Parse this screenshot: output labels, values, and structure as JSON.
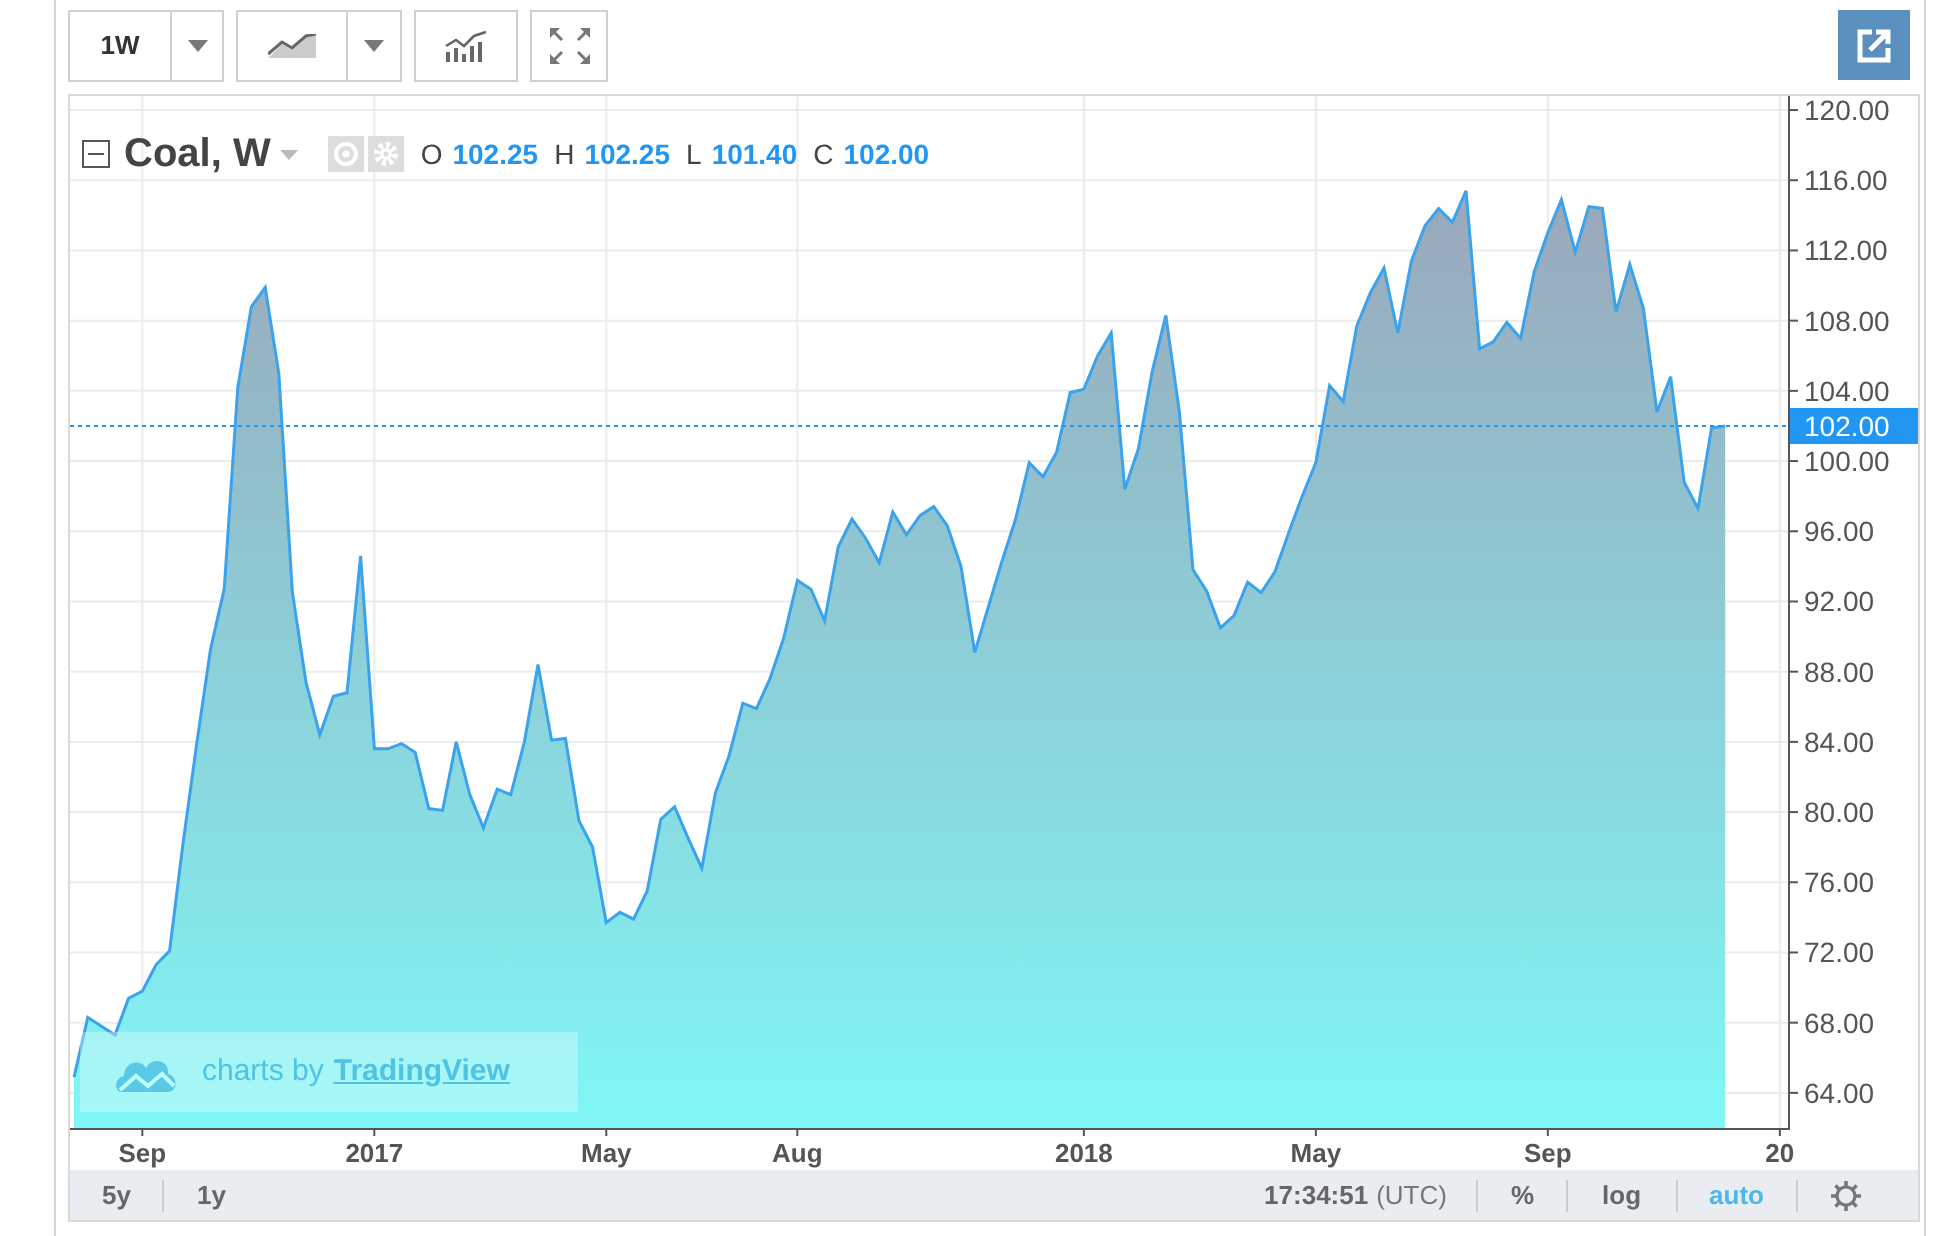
{
  "toolbar": {
    "interval": "1W"
  },
  "legend": {
    "values": [
      {
        "label": "O",
        "value": "102.25"
      },
      {
        "label": "H",
        "value": "102.25"
      },
      {
        "label": "L",
        "value": "101.40"
      },
      {
        "label": "C",
        "value": "102.00"
      }
    ]
  },
  "chart": {
    "chart_data": {
      "type": "area",
      "series": [
        {
          "name": "Coal, W",
          "color": "#3ba3ec",
          "values": [
            64.9,
            68.3,
            67.8,
            67.3,
            69.4,
            69.8,
            71.3,
            72.1,
            78.3,
            84.0,
            89.3,
            92.7,
            104.2,
            108.8,
            109.9,
            105.0,
            92.5,
            87.4,
            84.4,
            86.6,
            86.8,
            94.6,
            83.6,
            83.6,
            83.9,
            83.4,
            80.2,
            80.1,
            84.0,
            81.0,
            79.1,
            81.3,
            81.0,
            84.0,
            88.4,
            84.1,
            84.2,
            79.5,
            78.0,
            73.7,
            74.3,
            73.9,
            75.5,
            79.6,
            80.3,
            78.5,
            76.8,
            81.1,
            83.2,
            86.2,
            85.9,
            87.6,
            89.9,
            93.2,
            92.7,
            90.9,
            95.1,
            96.7,
            95.6,
            94.2,
            97.1,
            95.8,
            96.9,
            97.4,
            96.3,
            94.0,
            89.1,
            91.7,
            94.3,
            96.7,
            99.9,
            99.1,
            100.5,
            103.9,
            104.1,
            106.0,
            107.3,
            98.4,
            100.7,
            105.1,
            108.3,
            102.8,
            93.8,
            92.6,
            90.5,
            91.2,
            93.1,
            92.5,
            93.7,
            95.9,
            98.0,
            99.9,
            104.3,
            103.4,
            107.7,
            109.6,
            111.0,
            107.3,
            111.4,
            113.4,
            114.4,
            113.6,
            115.4,
            106.4,
            106.8,
            107.9,
            107.0,
            110.8,
            113.0,
            114.9,
            111.9,
            114.5,
            114.4,
            108.5,
            111.2,
            108.7,
            102.8,
            104.8,
            98.8,
            97.3,
            101.9,
            102.0,
            null,
            null,
            null,
            null
          ]
        }
      ],
      "categories": [
        null,
        null,
        null,
        null,
        null,
        "Sep",
        null,
        null,
        null,
        null,
        null,
        null,
        null,
        null,
        null,
        null,
        null,
        null,
        null,
        null,
        null,
        null,
        "2017",
        null,
        null,
        null,
        null,
        null,
        null,
        null,
        null,
        null,
        null,
        null,
        null,
        null,
        null,
        null,
        null,
        "May",
        null,
        null,
        null,
        null,
        null,
        null,
        null,
        null,
        null,
        null,
        null,
        null,
        null,
        "Aug",
        null,
        null,
        null,
        null,
        null,
        null,
        null,
        null,
        null,
        null,
        null,
        null,
        null,
        null,
        null,
        null,
        null,
        null,
        null,
        null,
        "2018",
        null,
        null,
        null,
        null,
        null,
        null,
        null,
        null,
        null,
        null,
        null,
        null,
        null,
        null,
        null,
        null,
        "May",
        null,
        null,
        null,
        null,
        null,
        null,
        null,
        null,
        null,
        null,
        null,
        null,
        null,
        null,
        null,
        null,
        "Sep",
        null,
        null,
        null,
        null,
        null,
        null,
        null,
        null,
        null,
        null,
        null,
        null,
        null,
        null,
        null,
        null,
        "20"
      ],
      "grid": true,
      "ref_lines": [
        {
          "axis": "y",
          "value": 102.0,
          "label": "102.00",
          "color": "#2196f3"
        }
      ],
      "ylim": [
        62,
        120.8
      ],
      "yticks": [
        {
          "value": 64,
          "label": "64.00"
        },
        {
          "value": 68,
          "label": "68.00"
        },
        {
          "value": 72,
          "label": "72.00"
        },
        {
          "value": 76,
          "label": "76.00"
        },
        {
          "value": 80,
          "label": "80.00"
        },
        {
          "value": 84,
          "label": "84.00"
        },
        {
          "value": 88,
          "label": "88.00"
        },
        {
          "value": 92,
          "label": "92.00"
        },
        {
          "value": 96,
          "label": "96.00"
        },
        {
          "value": 100,
          "label": "100.00"
        },
        {
          "value": 104,
          "label": "104.00"
        },
        {
          "value": 108,
          "label": "108.00"
        },
        {
          "value": 112,
          "label": "112.00"
        },
        {
          "value": 116,
          "label": "116.00"
        },
        {
          "value": 120,
          "label": "120.00"
        }
      ]
    },
    "attribution": {
      "prefix": "charts by",
      "link": "TradingView"
    }
  },
  "bottom_bar": {
    "ranges": [
      {
        "label": "5y"
      },
      {
        "label": "1y"
      }
    ],
    "time": "17:34:51",
    "timezone": "(UTC)",
    "options": [
      {
        "label": "%",
        "selected": false
      },
      {
        "label": "log",
        "selected": false
      },
      {
        "label": "auto",
        "selected": true
      }
    ]
  }
}
